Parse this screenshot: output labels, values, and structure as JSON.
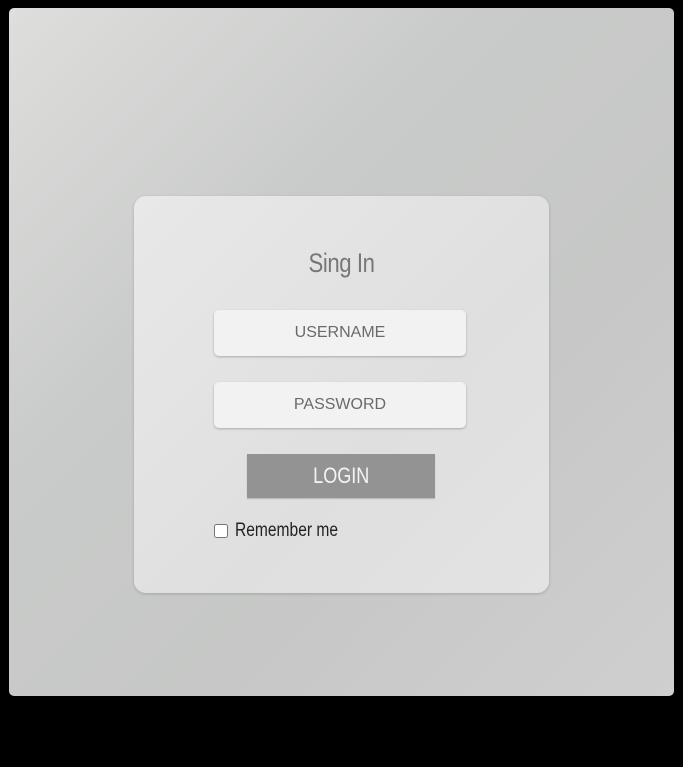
{
  "login": {
    "title": "Sing In",
    "username_placeholder": "USERNAME",
    "password_placeholder": "PASSWORD",
    "login_label": "LOGIN",
    "remember_label": "Remember me",
    "remember_checked": false
  },
  "colors": {
    "background": "#c9cbca",
    "card": "#e2e2e2",
    "field": "#f2f2f2",
    "button": "#939393",
    "button_text": "#f4f4f4",
    "title_text": "#777777"
  }
}
